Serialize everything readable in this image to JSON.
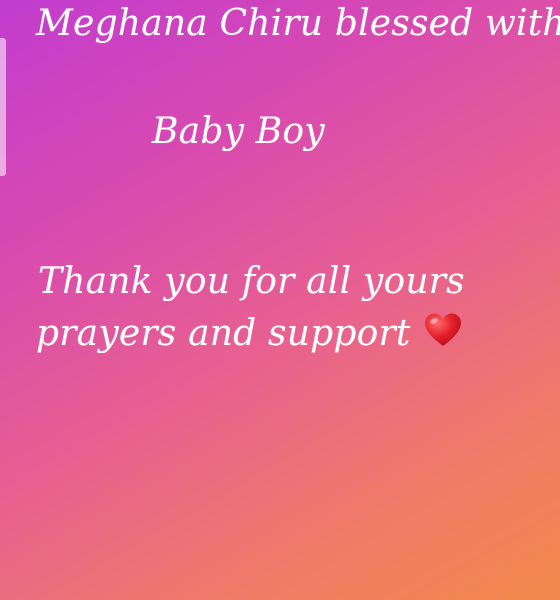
{
  "story": {
    "line1": "Meghana Chiru blessed with",
    "line2": "Baby Boy",
    "line3": "Thank you for all yours",
    "line4": "prayers and support"
  },
  "icons": {
    "heart": "red-heart-emoji"
  },
  "colors": {
    "gradient_start": "#c13ccf",
    "gradient_end": "#f2894a",
    "text": "#ffffff",
    "heart": "#e0202a"
  }
}
